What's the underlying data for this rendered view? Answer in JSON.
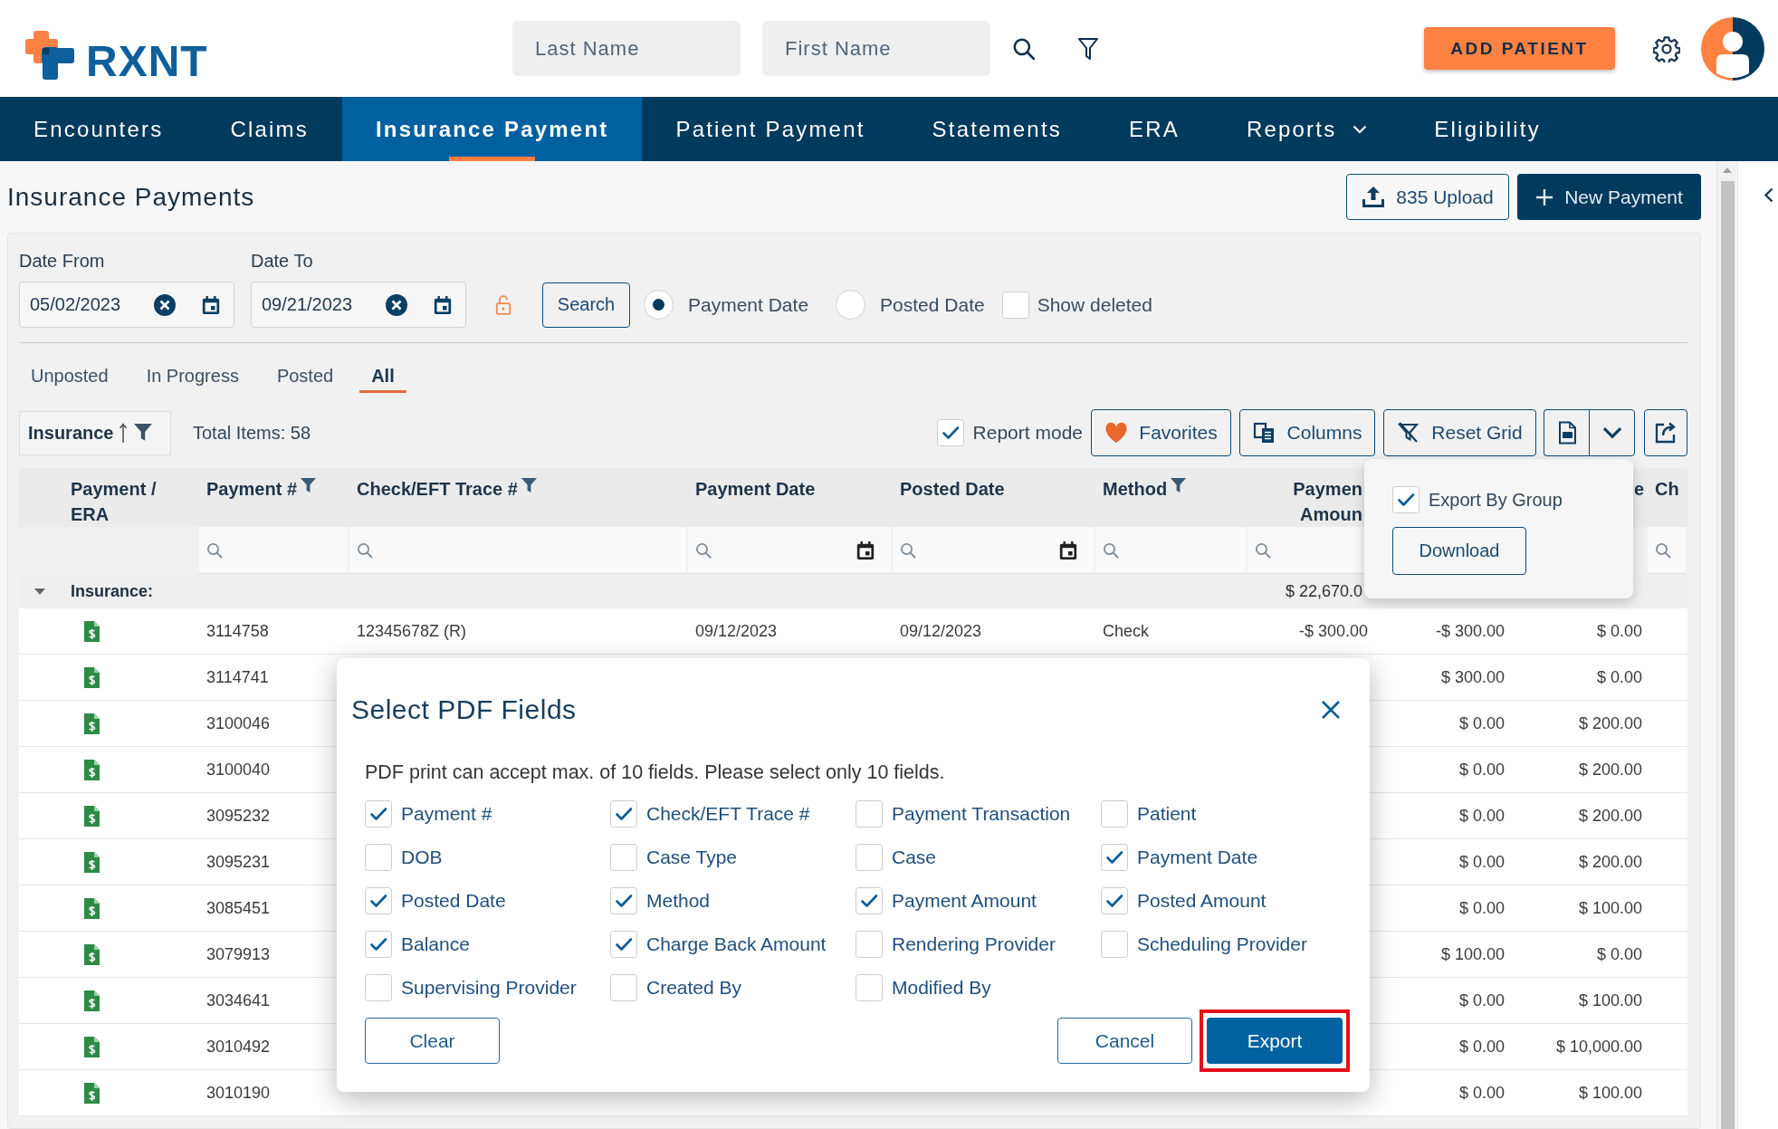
{
  "header": {
    "logo": "RXNT",
    "search_fields": [
      {
        "placeholder": "Last Name"
      },
      {
        "placeholder": "First Name"
      }
    ],
    "add_button": "ADD PATIENT"
  },
  "nav": [
    {
      "label": "Encounters",
      "selected": false,
      "has_menu": false
    },
    {
      "label": "Claims",
      "selected": false,
      "has_menu": false
    },
    {
      "label": "Insurance Payment",
      "selected": true,
      "has_menu": false
    },
    {
      "label": "Patient Payment",
      "selected": false,
      "has_menu": false
    },
    {
      "label": "Statements",
      "selected": false,
      "has_menu": false
    },
    {
      "label": "ERA",
      "selected": false,
      "has_menu": false
    },
    {
      "label": "Reports",
      "selected": false,
      "has_menu": true
    },
    {
      "label": "Eligibility",
      "selected": false,
      "has_menu": false
    }
  ],
  "page": {
    "title": "Insurance Payments",
    "actions": [
      {
        "label": "835 Upload",
        "kind": "upload"
      },
      {
        "label": "New Payment",
        "kind": "new"
      }
    ]
  },
  "filters": {
    "date_from": {
      "label": "Date From",
      "value": "05/02/2023"
    },
    "date_to": {
      "label": "Date To",
      "value": "09/21/2023"
    },
    "locked": false,
    "search_button": "Search",
    "date_type": [
      {
        "label": "Payment Date",
        "selected": true
      },
      {
        "label": "Posted Date",
        "selected": false
      }
    ],
    "show_deleted": {
      "label": "Show deleted",
      "checked": false
    }
  },
  "status_tabs": [
    {
      "label": "Unposted",
      "selected": false
    },
    {
      "label": "In Progress",
      "selected": false
    },
    {
      "label": "Posted",
      "selected": false
    },
    {
      "label": "All",
      "selected": true
    }
  ],
  "grid_toolbar": {
    "group_by": {
      "label": "Insurance"
    },
    "total_items": "Total Items: 58",
    "report_mode": {
      "label": "Report mode",
      "checked": true
    },
    "buttons": [
      {
        "label": "Favorites",
        "kind": "favorites"
      },
      {
        "label": "Columns",
        "kind": "columns"
      },
      {
        "label": "Reset Grid",
        "kind": "reset"
      }
    ]
  },
  "export_menu": {
    "expanded": true,
    "export_by_group": {
      "label": "Export By Group",
      "checked": true
    },
    "download": "Download"
  },
  "grid": {
    "columns": [
      {
        "label": "Payment / ERA",
        "kind": "icon",
        "filter_menu": false,
        "search_field": false
      },
      {
        "label": "Payment #",
        "kind": "text",
        "filter_menu": true,
        "search_field": true
      },
      {
        "label": "Check/EFT Trace #",
        "kind": "text",
        "filter_menu": true,
        "search_field": true
      },
      {
        "label": "Payment Date",
        "kind": "date",
        "filter_menu": false,
        "search_field": true
      },
      {
        "label": "Posted Date",
        "kind": "date",
        "filter_menu": false,
        "search_field": true
      },
      {
        "label": "Method",
        "kind": "text",
        "filter_menu": true,
        "search_field": true
      },
      {
        "label": "Paymen Amoun",
        "kind": "amount",
        "filter_menu": false,
        "search_field": true
      },
      {
        "kind": "amount"
      },
      {
        "label": "e",
        "kind": "amount",
        "filter_menu": false,
        "search_field": false
      },
      {
        "label": "Ch",
        "kind": "text",
        "filter_menu": false,
        "search_field": true
      }
    ],
    "group_row": {
      "label": "Insurance:",
      "expanded": true,
      "payment_amount": "$ 22,670.0"
    },
    "rows": [
      {
        "payment_no": "3114758",
        "trace_no": "12345678Z (R)",
        "payment_date": "09/12/2023",
        "posted_date": "09/12/2023",
        "method": "Check",
        "payment_amount": "-$ 300.00",
        "column_8": "-$ 300.00",
        "column_9": "$ 0.00"
      },
      {
        "payment_no": "3114741",
        "column_8": "$ 300.00",
        "column_9": "$ 0.00"
      },
      {
        "payment_no": "3100046",
        "column_8": "$ 0.00",
        "column_9": "$ 200.00"
      },
      {
        "payment_no": "3100040",
        "column_8": "$ 0.00",
        "column_9": "$ 200.00"
      },
      {
        "payment_no": "3095232",
        "column_8": "$ 0.00",
        "column_9": "$ 200.00"
      },
      {
        "payment_no": "3095231",
        "column_8": "$ 0.00",
        "column_9": "$ 200.00"
      },
      {
        "payment_no": "3085451",
        "column_8": "$ 0.00",
        "column_9": "$ 100.00"
      },
      {
        "payment_no": "3079913",
        "column_8": "$ 100.00",
        "column_9": "$ 0.00"
      },
      {
        "payment_no": "3034641",
        "column_8": "$ 0.00",
        "column_9": "$ 100.00"
      },
      {
        "payment_no": "3010492",
        "column_8": "$ 0.00",
        "column_9": "$ 10,000.00"
      },
      {
        "payment_no": "3010190",
        "column_8": "$ 0.00",
        "column_9": "$ 100.00"
      }
    ]
  },
  "pdf_dialog": {
    "title": "Select PDF Fields",
    "message": "PDF print can accept max. of 10 fields. Please select only 10 fields.",
    "fields": [
      {
        "label": "Payment #",
        "checked": true
      },
      {
        "label": "Check/EFT Trace #",
        "checked": true
      },
      {
        "label": "Payment Transaction",
        "checked": false
      },
      {
        "label": "Patient",
        "checked": false
      },
      {
        "label": "DOB",
        "checked": false
      },
      {
        "label": "Case Type",
        "checked": false
      },
      {
        "label": "Case",
        "checked": false
      },
      {
        "label": "Payment Date",
        "checked": true
      },
      {
        "label": "Posted Date",
        "checked": true
      },
      {
        "label": "Method",
        "checked": true
      },
      {
        "label": "Payment Amount",
        "checked": true
      },
      {
        "label": "Posted Amount",
        "checked": true
      },
      {
        "label": "Balance",
        "checked": true
      },
      {
        "label": "Charge Back Amount",
        "checked": true
      },
      {
        "label": "Rendering Provider",
        "checked": false
      },
      {
        "label": "Scheduling Provider",
        "checked": false
      },
      {
        "label": "Supervising Provider",
        "checked": false
      },
      {
        "label": "Created By",
        "checked": false
      },
      {
        "label": "Modified By",
        "checked": false
      }
    ],
    "buttons": [
      {
        "label": "Clear",
        "kind": "outline",
        "highlighted": false
      },
      {
        "label": "Cancel",
        "kind": "outline",
        "highlighted": false
      },
      {
        "label": "Export",
        "kind": "primary",
        "highlighted": true
      }
    ]
  }
}
